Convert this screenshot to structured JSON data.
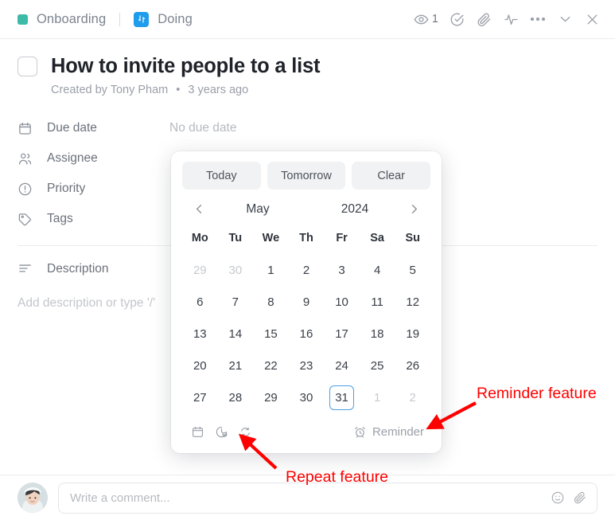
{
  "topbar": {
    "list_name": "Onboarding",
    "list_color": "#3dbaa8",
    "status_name": "Doing",
    "status_color": "#1f9cec",
    "watch_count": "1",
    "icons": [
      "eye-icon",
      "check-circle-icon",
      "paperclip-icon",
      "activity-icon",
      "more-icon",
      "collapse-icon",
      "close-icon"
    ]
  },
  "task": {
    "title": "How to invite people to a list",
    "created_by_prefix": "Created by",
    "author": "Tony Pham",
    "separator": "•",
    "created_ago": "3 years ago"
  },
  "properties": [
    {
      "label": "Due date",
      "value": "No due date",
      "icon": "calendar-icon"
    },
    {
      "label": "Assignee",
      "value": "",
      "icon": "people-icon"
    },
    {
      "label": "Priority",
      "value": "",
      "icon": "priority-icon"
    },
    {
      "label": "Tags",
      "value": "",
      "icon": "tag-icon"
    }
  ],
  "description": {
    "label": "Description",
    "placeholder": "Add description or type '/'"
  },
  "datepicker": {
    "quick": [
      {
        "label": "Today"
      },
      {
        "label": "Tomorrow"
      },
      {
        "label": "Clear"
      }
    ],
    "month": "May",
    "year": "2024",
    "weekdays": [
      "Mo",
      "Tu",
      "We",
      "Th",
      "Fr",
      "Sa",
      "Su"
    ],
    "weeks": [
      [
        {
          "d": "29",
          "muted": true
        },
        {
          "d": "30",
          "muted": true
        },
        {
          "d": "1"
        },
        {
          "d": "2"
        },
        {
          "d": "3"
        },
        {
          "d": "4"
        },
        {
          "d": "5"
        }
      ],
      [
        {
          "d": "6"
        },
        {
          "d": "7"
        },
        {
          "d": "8"
        },
        {
          "d": "9"
        },
        {
          "d": "10"
        },
        {
          "d": "11"
        },
        {
          "d": "12"
        }
      ],
      [
        {
          "d": "13"
        },
        {
          "d": "14"
        },
        {
          "d": "15"
        },
        {
          "d": "16"
        },
        {
          "d": "17"
        },
        {
          "d": "18"
        },
        {
          "d": "19"
        }
      ],
      [
        {
          "d": "20"
        },
        {
          "d": "21"
        },
        {
          "d": "22"
        },
        {
          "d": "23"
        },
        {
          "d": "24"
        },
        {
          "d": "25"
        },
        {
          "d": "26"
        }
      ],
      [
        {
          "d": "27"
        },
        {
          "d": "28"
        },
        {
          "d": "29"
        },
        {
          "d": "30"
        },
        {
          "d": "31",
          "today": true
        },
        {
          "d": "1",
          "muted": true
        },
        {
          "d": "2",
          "muted": true
        }
      ]
    ],
    "selected_day": "31",
    "selected_highlight_color": "#4a9fe8",
    "footer_icons": [
      "calendar-icon",
      "time-icon",
      "repeat-icon"
    ],
    "reminder_label": "Reminder"
  },
  "comment": {
    "placeholder": "Write a comment...",
    "icons": [
      "emoji-icon",
      "attachment-icon"
    ]
  },
  "annotations": [
    {
      "id": "reminder",
      "text": "Reminder feature",
      "color": "#ff0000"
    },
    {
      "id": "repeat",
      "text": "Repeat feature",
      "color": "#ff0000"
    }
  ]
}
